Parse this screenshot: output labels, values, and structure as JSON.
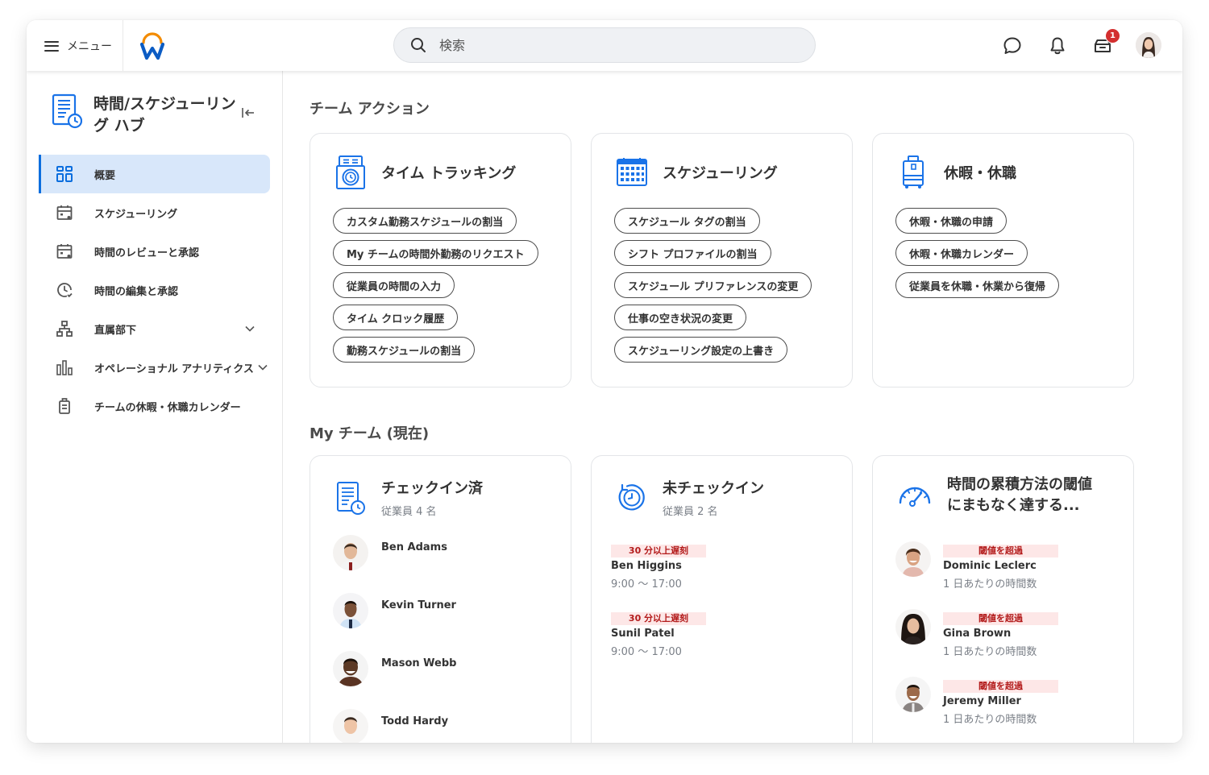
{
  "header": {
    "menu_label": "メニュー",
    "search_placeholder": "検索",
    "notification_badge": "1",
    "icons": [
      "menu-icon",
      "workday-logo",
      "search-icon",
      "chat-icon",
      "bell-icon",
      "inbox-icon",
      "user-avatar"
    ]
  },
  "sidebar": {
    "hub_title": "時間/スケジューリング ハブ",
    "items": [
      {
        "label": "概要",
        "icon": "grid-icon",
        "active": true
      },
      {
        "label": "スケジューリング",
        "icon": "calendar-icon"
      },
      {
        "label": "時間のレビューと承認",
        "icon": "calendar-icon"
      },
      {
        "label": "時間の編集と承認",
        "icon": "clock-check-icon"
      },
      {
        "label": "直属部下",
        "icon": "org-chart-icon",
        "expandable": true
      },
      {
        "label": "オペレーショナル アナリティクス",
        "icon": "bar-chart-icon",
        "expandable": true
      },
      {
        "label": "チームの休暇・休職カレンダー",
        "icon": "luggage-icon"
      }
    ]
  },
  "team_actions": {
    "title": "チーム アクション",
    "cards": [
      {
        "title": "タイム トラッキング",
        "icon": "time-clock-icon",
        "actions": [
          "カスタム勤務スケジュールの割当",
          "My チームの時間外勤務のリクエスト",
          "従業員の時間の入力",
          "タイム クロック履歴",
          "勤務スケジュールの割当"
        ]
      },
      {
        "title": "スケジューリング",
        "icon": "calendar-grid-icon",
        "actions": [
          "スケジュール タグの割当",
          "シフト プロファイルの割当",
          "スケジュール プリファレンスの変更",
          "仕事の空き状況の変更",
          "スケジューリング設定の上書き"
        ]
      },
      {
        "title": "休暇・休職",
        "icon": "luggage-icon",
        "actions": [
          "休暇・休職の申請",
          "休暇・休職カレンダー",
          "従業員を休職・休業から復帰"
        ]
      }
    ]
  },
  "my_team": {
    "title": "My チーム (現在)",
    "checked_in": {
      "title": "チェックイン済",
      "subtitle": "従業員 4 名",
      "people": [
        "Ben Adams",
        "Kevin Turner",
        "Mason Webb",
        "Todd Hardy"
      ]
    },
    "not_checked_in": {
      "title": "未チェックイン",
      "subtitle": "従業員 2 名",
      "people": [
        {
          "tag": "30 分以上遅刻",
          "name": "Ben Higgins",
          "shift": "9:00 〜 17:00"
        },
        {
          "tag": "30 分以上遅刻",
          "name": "Sunil Patel",
          "shift": "9:00 〜 17:00"
        }
      ]
    },
    "threshold": {
      "title": "時間の累積方法の閾値にまもなく達する...",
      "people": [
        {
          "tag": "閾値を超過",
          "name": "Dominic Leclerc",
          "detail": "1 日あたりの時間数"
        },
        {
          "tag": "閾値を超過",
          "name": "Gina Brown",
          "detail": "1 日あたりの時間数"
        },
        {
          "tag": "閾値を超過",
          "name": "Jeremy Miller",
          "detail": "1 日あたりの時間数"
        }
      ]
    }
  },
  "colors": {
    "accent": "#0b6ede",
    "icon_blue": "#1a73e8",
    "logo_orange": "#f38b00",
    "badge_red": "#d32f2f",
    "tag_bg": "#fde7e7",
    "tag_text": "#b31b1b",
    "active_nav_bg": "#d8e7fa"
  }
}
